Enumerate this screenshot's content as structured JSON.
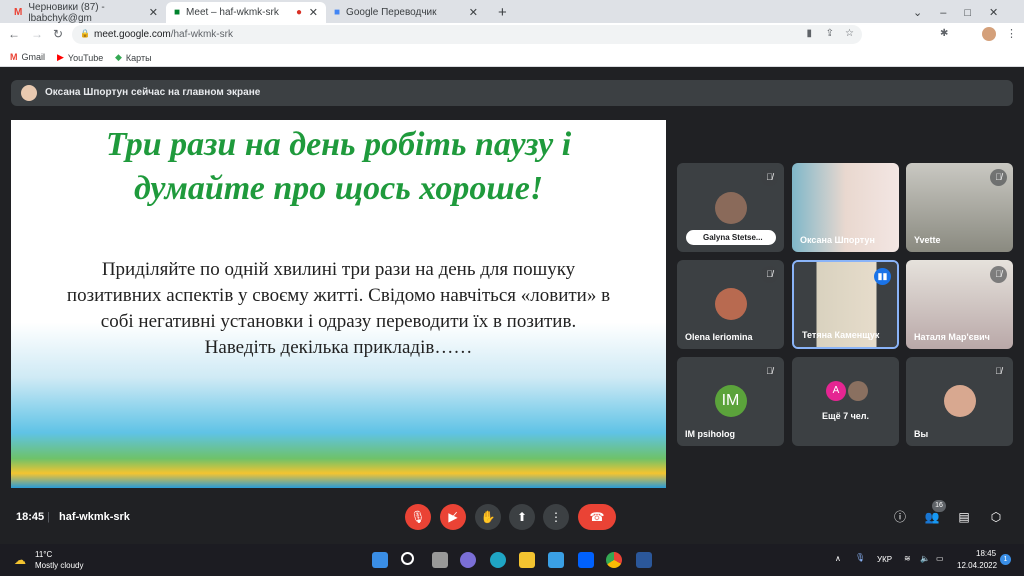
{
  "browser": {
    "tabs": [
      {
        "title": "Черновики (87) - lbabchyk@gm"
      },
      {
        "title": "Meet – haf-wkmk-srk",
        "active": true
      },
      {
        "title": "Google Переводчик"
      }
    ],
    "url_host": "meet.google.com",
    "url_path": "/haf-wkmk-srk",
    "bookmarks": [
      "Gmail",
      "YouTube",
      "Карты"
    ]
  },
  "banner": "Оксана Шпортун сейчас на главном экране",
  "slide": {
    "title_line1": "Три рази на день робіть паузу і",
    "title_line2": "думайте про щось хороше!",
    "body_lines": [
      "Приділяйте по одній хвилині три рази на день для пошуку",
      "позитивних аспектів у своєму житті. Свідомо навчіться «ловити» в",
      "собі негативні установки і одразу переводити їх в позитив.",
      "Наведіть декілька прикладів……"
    ]
  },
  "participants": [
    {
      "name": "Galyna Stetse...",
      "muted": true,
      "video": false
    },
    {
      "name": "Оксана Шпортун",
      "muted": false,
      "video": true
    },
    {
      "name": "Yvette",
      "muted": true,
      "video": true
    },
    {
      "name": "Olena Ieriomina",
      "muted": true,
      "video": false
    },
    {
      "name": "Тетяна Каменщук",
      "muted": false,
      "video": true,
      "speaking": true
    },
    {
      "name": "Наталя Мар'євич",
      "muted": true,
      "video": true
    },
    {
      "name": "IM psiholog",
      "initials": "IM",
      "muted": true,
      "video": false
    },
    {
      "name": "Ещё 7 чел.",
      "initials": "A"
    },
    {
      "name": "Вы",
      "muted": true,
      "video": false
    }
  ],
  "bottom": {
    "time": "18:45",
    "meeting_code": "haf-wkmk-srk",
    "people_count": "16"
  },
  "taskbar": {
    "temp": "11°C",
    "weather": "Mostly cloudy",
    "lang": "УКР",
    "time": "18:45",
    "date": "12.04.2022",
    "notif": "1"
  }
}
